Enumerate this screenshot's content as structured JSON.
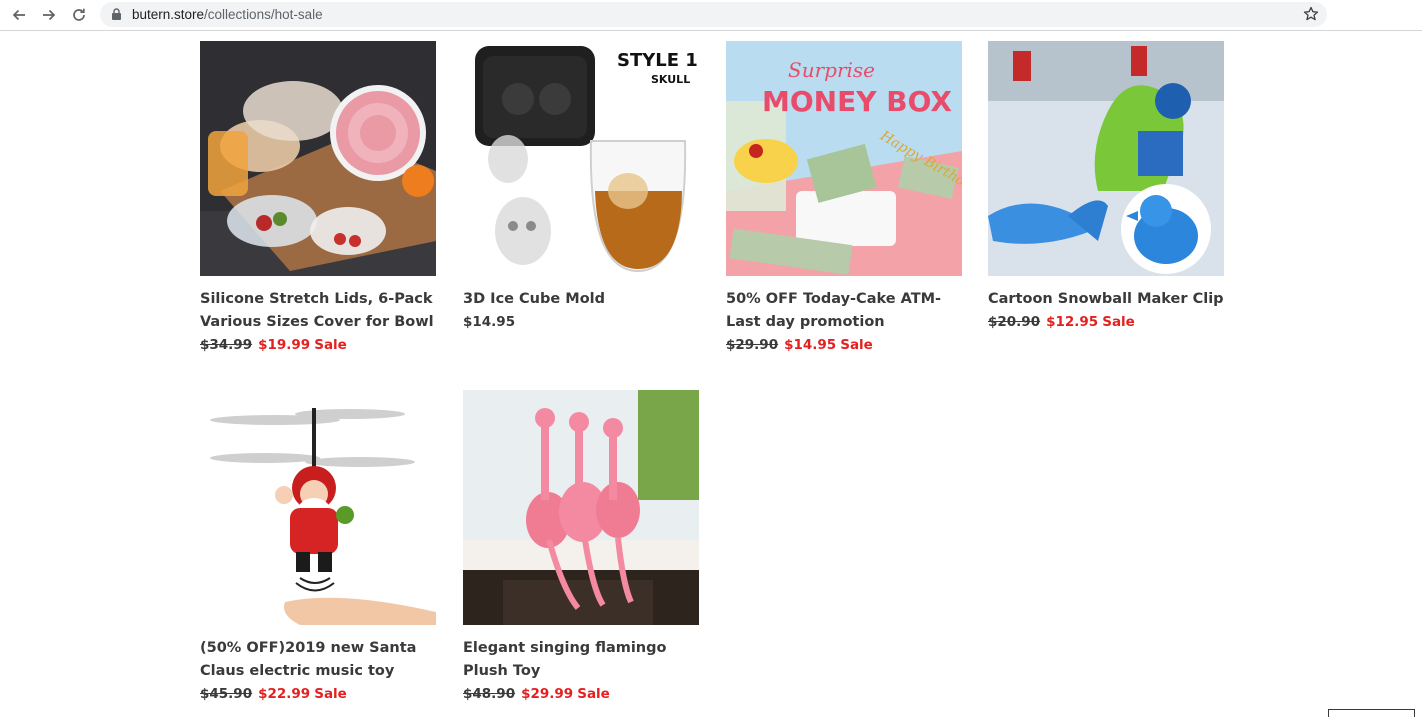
{
  "browser": {
    "url_domain": "butern.store",
    "url_path": "/collections/hot-sale",
    "back_icon": "arrow-left-icon",
    "forward_icon": "arrow-right-icon",
    "reload_icon": "reload-icon",
    "bookmark_icon": "star-icon"
  },
  "colors": {
    "sale": "#e22120",
    "text": "#3a3a3a"
  },
  "products": [
    {
      "title": "Silicone Stretch Lids, 6-Pack Various Sizes Cover for Bowl",
      "old_price": "$34.99",
      "price": "$19.99",
      "sale_label": "Sale"
    },
    {
      "title": "3D Ice Cube Mold",
      "price": "$14.95",
      "image_text_1": "STYLE 1",
      "image_text_2": "SKULL"
    },
    {
      "title": "50% OFF Today-Cake ATM-Last day promotion",
      "old_price": "$29.90",
      "price": "$14.95",
      "sale_label": "Sale",
      "image_text_1": "Surprise",
      "image_text_2": "MONEY BOX",
      "image_text_3": "Happy Birthday"
    },
    {
      "title": "Cartoon Snowball Maker Clip",
      "old_price": "$20.90",
      "price": "$12.95",
      "sale_label": "Sale"
    },
    {
      "title": "(50% OFF)2019 new Santa Claus electric music toy",
      "old_price": "$45.90",
      "price": "$22.99",
      "sale_label": "Sale"
    },
    {
      "title": "Elegant singing flamingo Plush Toy",
      "old_price": "$48.90",
      "price": "$29.99",
      "sale_label": "Sale"
    }
  ]
}
